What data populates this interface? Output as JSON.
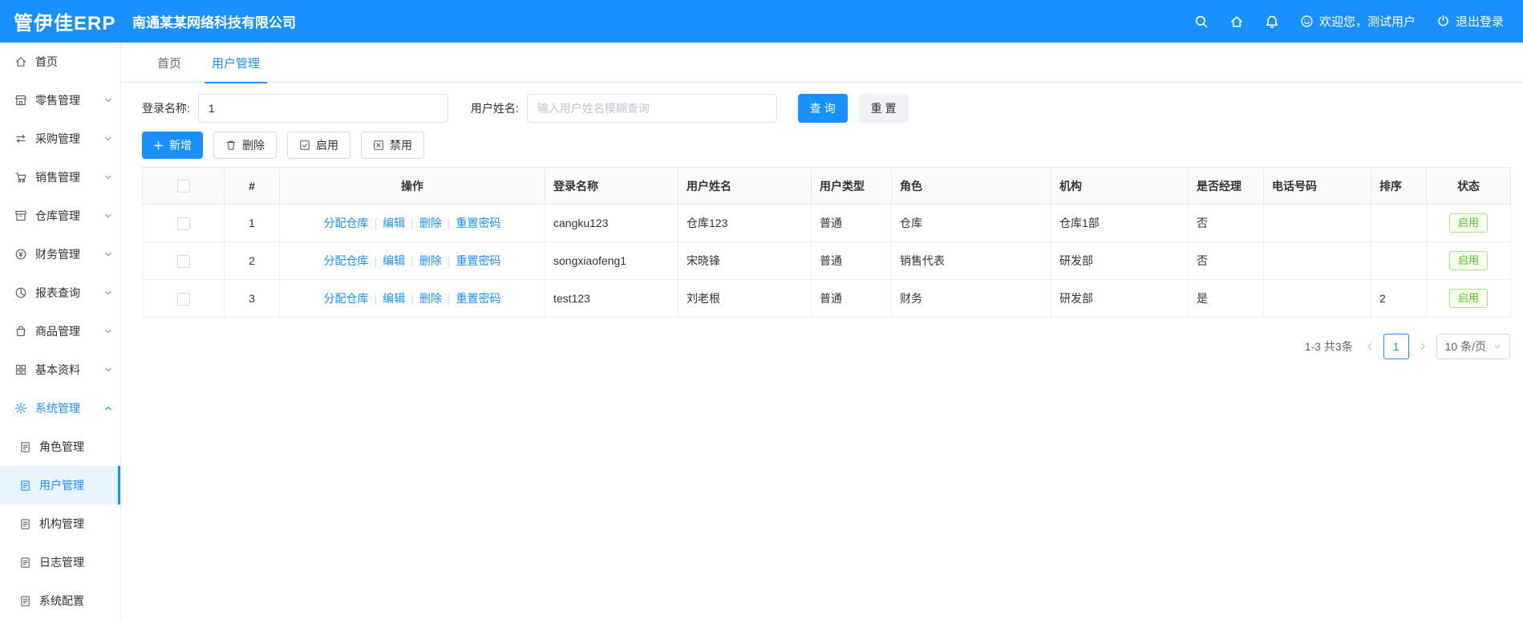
{
  "topbar": {
    "logo": "管伊佳ERP",
    "company": "南通某某网络科技有限公司",
    "welcome": "欢迎您，测试用户",
    "logout": "退出登录"
  },
  "sidebar": {
    "items": [
      {
        "label": "首页"
      },
      {
        "label": "零售管理"
      },
      {
        "label": "采购管理"
      },
      {
        "label": "销售管理"
      },
      {
        "label": "仓库管理"
      },
      {
        "label": "财务管理"
      },
      {
        "label": "报表查询"
      },
      {
        "label": "商品管理"
      },
      {
        "label": "基本资料"
      },
      {
        "label": "系统管理"
      }
    ],
    "sub_items": [
      {
        "label": "角色管理"
      },
      {
        "label": "用户管理"
      },
      {
        "label": "机构管理"
      },
      {
        "label": "日志管理"
      },
      {
        "label": "系统配置"
      }
    ]
  },
  "tabs": {
    "items": [
      {
        "label": "首页"
      },
      {
        "label": "用户管理"
      }
    ]
  },
  "filters": {
    "login_label": "登录名称:",
    "login_value": "1",
    "name_label": "用户姓名:",
    "name_placeholder": "输入用户姓名模糊查询",
    "search_button": "查 询",
    "reset_button": "重 置"
  },
  "toolbar": {
    "add": "新增",
    "delete": "删除",
    "enable": "启用",
    "disable": "禁用"
  },
  "table": {
    "headers": {
      "index": "#",
      "action": "操作",
      "login": "登录名称",
      "name": "用户姓名",
      "type": "用户类型",
      "role": "角色",
      "org": "机构",
      "manager": "是否经理",
      "phone": "电话号码",
      "sort": "排序",
      "status": "状态"
    },
    "action_links": {
      "assign": "分配仓库",
      "edit": "编辑",
      "del": "删除",
      "reset_pwd": "重置密码"
    },
    "rows": [
      {
        "index": "1",
        "login": "cangku123",
        "name": "仓库123",
        "type": "普通",
        "role": "仓库",
        "org": "仓库1部",
        "manager": "否",
        "phone": "",
        "sort": "",
        "status": "启用"
      },
      {
        "index": "2",
        "login": "songxiaofeng1",
        "name": "宋晓锋",
        "type": "普通",
        "role": "销售代表",
        "org": "研发部",
        "manager": "否",
        "phone": "",
        "sort": "",
        "status": "启用"
      },
      {
        "index": "3",
        "login": "test123",
        "name": "刘老根",
        "type": "普通",
        "role": "财务",
        "org": "研发部",
        "manager": "是",
        "phone": "",
        "sort": "2",
        "status": "启用"
      }
    ]
  },
  "pagination": {
    "summary": "1-3 共3条",
    "current_page": "1",
    "page_size": "10 条/页"
  }
}
